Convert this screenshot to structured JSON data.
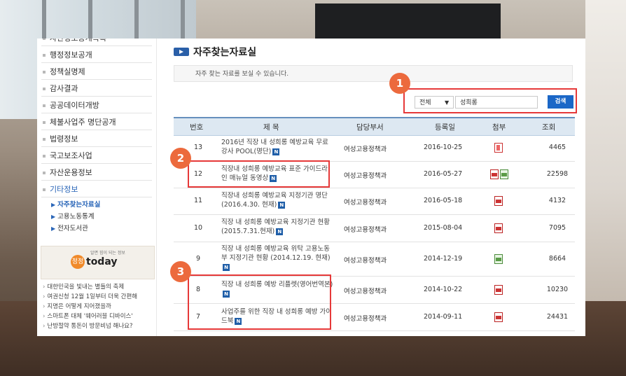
{
  "nav": {
    "items": [
      "자산정보공개목록",
      "행정정보공개",
      "정책실명제",
      "감사결과",
      "공공데이터개방",
      "체불사업주 명단공개",
      "법령정보",
      "국고보조사업",
      "자산운용정보",
      "기타정보"
    ],
    "subitems": [
      "자주찾는자료실",
      "고용노동통계",
      "전자도서관"
    ],
    "today": {
      "logo": "정정",
      "title": "today",
      "tagline": "알면 힘이 되는 정보"
    },
    "news": [
      "대한민국을 빛내는 별들의 축제",
      "여권신청 12월 1일부터 더욱 간편해",
      "지명은 어떻게 지어졌을까",
      "스마트폰 대체 '웨어러블 디바이스'",
      "난방절약 통돈이 방문비넘 해나요?"
    ]
  },
  "main": {
    "title": "자주찾는자료실",
    "intro": "자주 찾는 자료를 보실 수 있습니다.",
    "search": {
      "scope": "전체",
      "query": "성희롱",
      "button": "검색"
    },
    "headers": [
      "번호",
      "제 목",
      "담당부서",
      "등록일",
      "첨부",
      "조회"
    ],
    "rows": [
      {
        "num": "13",
        "title": "2016년 직장 내 성희롱 예방교육 무료강사 POOL(명단)",
        "dept": "여성고용정책과",
        "date": "2016-10-25",
        "att": "file-icon",
        "views": "4465"
      },
      {
        "num": "12",
        "title": "직장내 성희롱 예방교육 표준 가이드라인 매뉴얼 동영상",
        "dept": "여성고용정책과",
        "date": "2016-05-27",
        "att": "pdf-hwp-icon",
        "views": "22598"
      },
      {
        "num": "11",
        "title": "직장내 성희롱 예방교육 지정기관 명단(2016.4.30. 현재)",
        "dept": "여성고용정책과",
        "date": "2016-05-18",
        "att": "pdf-icon",
        "views": "4132"
      },
      {
        "num": "10",
        "title": "직장 내 성희롱 예방교육 지정기관 현황(2015.7.31.현재)",
        "dept": "여성고용정책과",
        "date": "2015-08-04",
        "att": "pdf-icon",
        "views": "7095"
      },
      {
        "num": "9",
        "title": "직장 내 성희롱 예방교육 위탁 고용노동부 지정기관 현황 (2014.12.19. 현재)",
        "dept": "여성고용정책과",
        "date": "2014-12-19",
        "att": "hwp-icon",
        "views": "8664"
      },
      {
        "num": "8",
        "title": "직장 내 성희롱 예방 리플렛(영어번역본)",
        "dept": "여성고용정책과",
        "date": "2014-10-22",
        "att": "pdf-icon",
        "views": "10230"
      },
      {
        "num": "7",
        "title": "사업주를 위한 직장 내 성희롱 예방 가이드북",
        "dept": "여성고용정책과",
        "date": "2014-09-11",
        "att": "pdf-icon",
        "views": "24431"
      }
    ],
    "new_badge": "N",
    "callouts": [
      "1",
      "2",
      "3"
    ]
  }
}
